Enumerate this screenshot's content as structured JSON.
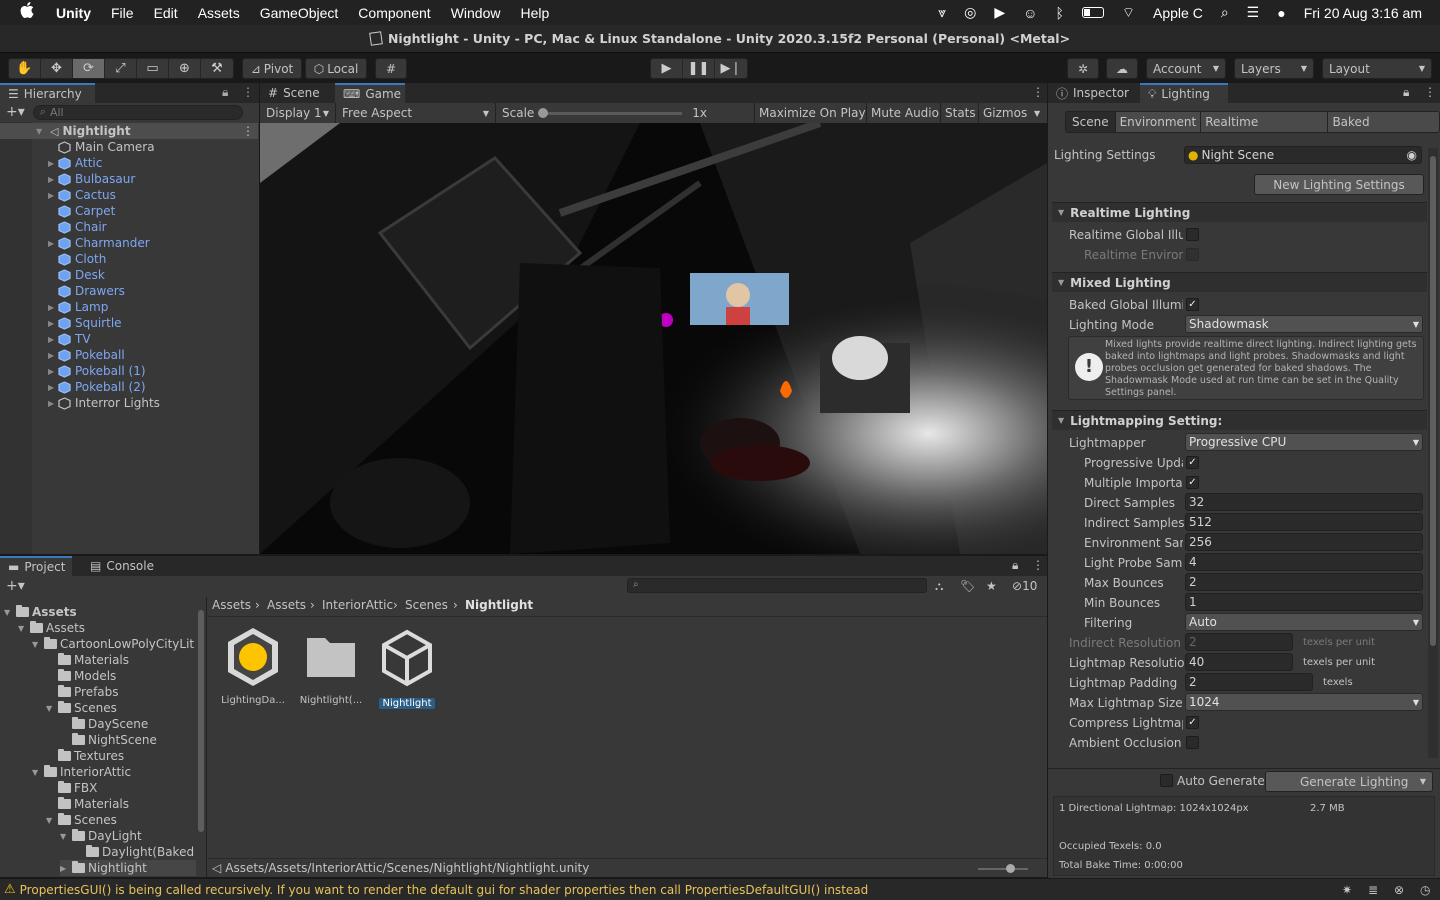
{
  "mac_menu": {
    "apple": "",
    "app": "Unity",
    "items": [
      "File",
      "Edit",
      "Assets",
      "GameObject",
      "Component",
      "Window",
      "Help"
    ],
    "user": "Apple C",
    "clock": "Fri 20 Aug  3:16 am"
  },
  "window": {
    "title": "Nightlight - Unity - PC, Mac & Linux Standalone - Unity 2020.3.15f2 Personal (Personal) <Metal>"
  },
  "toolbar": {
    "pivot": "Pivot",
    "local": "Local",
    "account": "Account",
    "layers": "Layers",
    "layout": "Layout"
  },
  "hierarchy": {
    "tab": "Hierarchy",
    "search_placeholder": "All",
    "scene": "Nightlight",
    "items": [
      {
        "label": "Main Camera",
        "blue": false,
        "arrow": false
      },
      {
        "label": "Attic",
        "blue": true,
        "arrow": true
      },
      {
        "label": "Bulbasaur",
        "blue": true,
        "arrow": true
      },
      {
        "label": "Cactus",
        "blue": true,
        "arrow": true
      },
      {
        "label": "Carpet",
        "blue": true,
        "arrow": false
      },
      {
        "label": "Chair",
        "blue": true,
        "arrow": false
      },
      {
        "label": "Charmander",
        "blue": true,
        "arrow": true
      },
      {
        "label": "Cloth",
        "blue": true,
        "arrow": false
      },
      {
        "label": "Desk",
        "blue": true,
        "arrow": false
      },
      {
        "label": "Drawers",
        "blue": true,
        "arrow": false
      },
      {
        "label": "Lamp",
        "blue": true,
        "arrow": true
      },
      {
        "label": "Squirtle",
        "blue": true,
        "arrow": true
      },
      {
        "label": "TV",
        "blue": true,
        "arrow": true
      },
      {
        "label": "Pokeball",
        "blue": true,
        "arrow": true
      },
      {
        "label": "Pokeball (1)",
        "blue": true,
        "arrow": true
      },
      {
        "label": "Pokeball (2)",
        "blue": true,
        "arrow": true
      },
      {
        "label": "Interror Lights",
        "blue": false,
        "arrow": true
      }
    ]
  },
  "game": {
    "tabs": [
      "Scene",
      "Game"
    ],
    "display": "Display 1",
    "aspect": "Free Aspect",
    "scale_label": "Scale",
    "scale_value": "1x",
    "buttons": [
      "Maximize On Play",
      "Mute Audio",
      "Stats",
      "Gizmos"
    ]
  },
  "inspector": {
    "tabs": [
      "Inspector",
      "Lighting"
    ],
    "subtabs": [
      "Scene",
      "Environment",
      "Realtime Lightmaps",
      "Baked Lightmaps"
    ],
    "settings_label": "Lighting Settings",
    "settings_value": "Night Scene",
    "new_settings": "New Lighting Settings",
    "realtime_header": "Realtime Lighting",
    "realtime_gi": "Realtime Global Illum",
    "realtime_env": "Realtime Environm",
    "mixed_header": "Mixed Lighting",
    "baked_gi": "Baked Global Illumin",
    "lighting_mode_label": "Lighting Mode",
    "lighting_mode": "Shadowmask",
    "mixed_info": "Mixed lights provide realtime direct lighting. Indirect lighting gets baked into lightmaps and light probes. Shadowmasks and light probes occlusion get generated for baked shadows. The Shadowmask Mode used at run time can be set in the Quality Settings panel.",
    "lightmapping_header": "Lightmapping Setting:",
    "lightmapper_label": "Lightmapper",
    "lightmapper": "Progressive CPU",
    "progressive_updates": "Progressive Upda",
    "multiple_importance": "Multiple Importan",
    "direct_samples_label": "Direct Samples",
    "direct_samples": "32",
    "indirect_samples_label": "Indirect Samples",
    "indirect_samples": "512",
    "env_samples_label": "Environment Sam",
    "env_samples": "256",
    "probe_samples_label": "Light Probe Samp",
    "probe_samples": "4",
    "max_bounces_label": "Max Bounces",
    "max_bounces": "2",
    "min_bounces_label": "Min Bounces",
    "min_bounces": "1",
    "filtering_label": "Filtering",
    "filtering": "Auto",
    "indirect_res_label": "Indirect Resolution",
    "indirect_res": "2",
    "texels_per_unit": "texels per unit",
    "lightmap_res_label": "Lightmap Resolution",
    "lightmap_res": "40",
    "padding_label": "Lightmap Padding",
    "padding": "2",
    "texels": "texels",
    "max_size_label": "Max Lightmap Size",
    "max_size": "1024",
    "compress_label": "Compress Lightmaps",
    "ao_label": "Ambient Occlusion",
    "auto_generate": "Auto Generate",
    "generate": "Generate Lighting",
    "stats_lightmap": "1 Directional Lightmap: 1024x1024px",
    "stats_size": "2.7 MB",
    "occupied": "Occupied Texels: 0.0",
    "bake_time": "Total Bake Time: 0:00:00"
  },
  "project": {
    "tabs": [
      "Project",
      "Console"
    ],
    "hidden_count": "10",
    "tree": [
      {
        "label": "Assets",
        "level": 0,
        "bold": true,
        "arrow": "open"
      },
      {
        "label": "Assets",
        "level": 1,
        "arrow": "open"
      },
      {
        "label": "CartoonLowPolyCityLit",
        "level": 2,
        "arrow": "open"
      },
      {
        "label": "Materials",
        "level": 3,
        "arrow": ""
      },
      {
        "label": "Models",
        "level": 3,
        "arrow": ""
      },
      {
        "label": "Prefabs",
        "level": 3,
        "arrow": ""
      },
      {
        "label": "Scenes",
        "level": 3,
        "arrow": "open"
      },
      {
        "label": "DayScene",
        "level": 4,
        "arrow": ""
      },
      {
        "label": "NightScene",
        "level": 4,
        "arrow": ""
      },
      {
        "label": "Textures",
        "level": 3,
        "arrow": ""
      },
      {
        "label": "InteriorAttic",
        "level": 2,
        "arrow": "open"
      },
      {
        "label": "FBX",
        "level": 3,
        "arrow": ""
      },
      {
        "label": "Materials",
        "level": 3,
        "arrow": ""
      },
      {
        "label": "Scenes",
        "level": 3,
        "arrow": "open"
      },
      {
        "label": "DayLight",
        "level": 4,
        "arrow": "open"
      },
      {
        "label": "Daylight(Baked",
        "level": 5,
        "arrow": ""
      },
      {
        "label": "Nightlight",
        "level": 4,
        "arrow": "closed"
      }
    ],
    "breadcrumb": [
      "Assets",
      "Assets",
      "InteriorAttic",
      "Scenes",
      "Nightlight"
    ],
    "assets": [
      "LightingDa...",
      "Nightlight(...",
      "Nightlight"
    ],
    "path": "Assets/Assets/InteriorAttic/Scenes/Nightlight/Nightlight.unity"
  },
  "status": {
    "message": "PropertiesGUI() is being called recursively. If you want to render the default gui for shader properties then call PropertiesDefaultGUI() instead"
  },
  "colors": {
    "accent": "#3a79bb",
    "panel": "#383838",
    "dark": "#282828",
    "warning": "#f0c419"
  }
}
